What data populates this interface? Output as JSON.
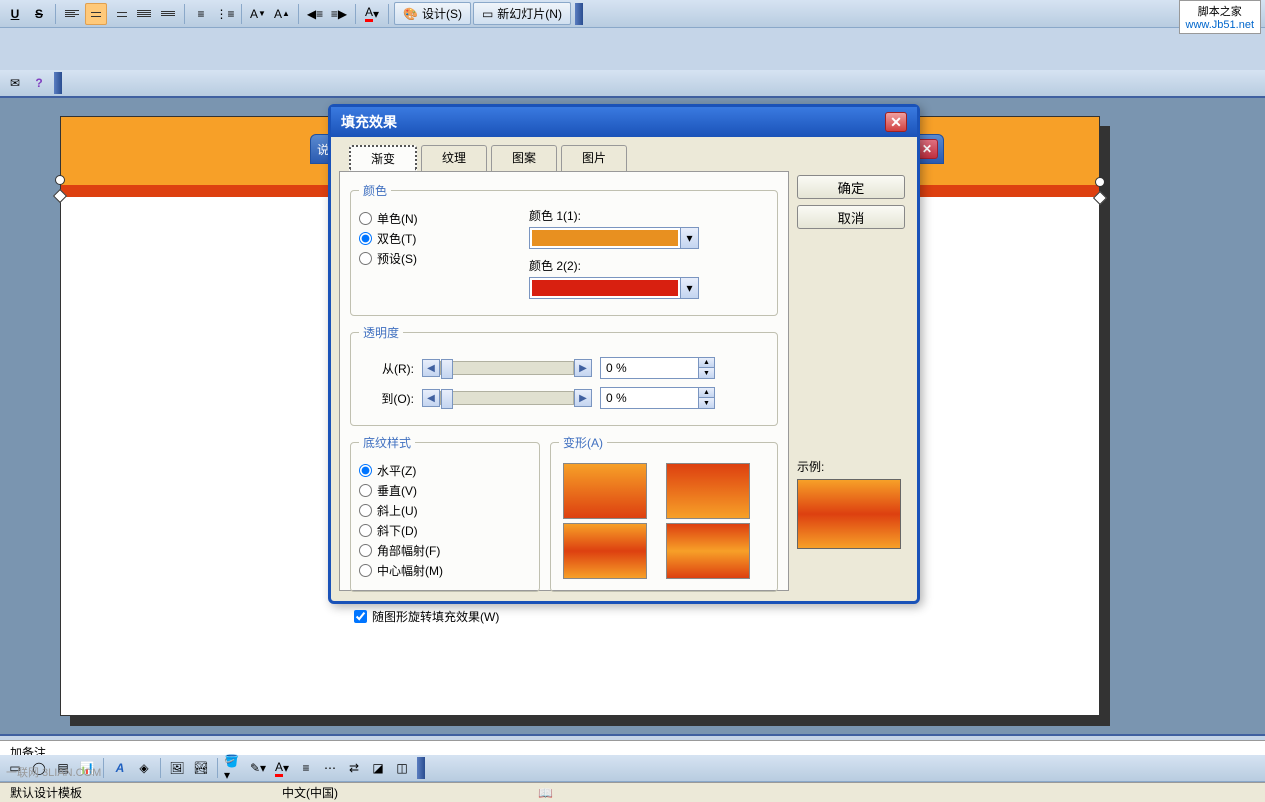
{
  "toolbar": {
    "underline": "U",
    "strike": "S",
    "design": "设计(S)",
    "new_slide": "新幻灯片(N)",
    "help": "?",
    "font_color": "A",
    "indent_dec": "A",
    "indent_inc": "A"
  },
  "watermark": {
    "name": "脚本之家",
    "url": "www.Jb51.net",
    "bottomleft": "一联网 3LIAN.COM"
  },
  "subdialog_title": "说",
  "dialog": {
    "title": "填充效果",
    "tabs": {
      "gradient": "渐变",
      "texture": "纹理",
      "pattern": "图案",
      "picture": "图片"
    },
    "color_group": "颜色",
    "single": "单色(N)",
    "double": "双色(T)",
    "preset": "预设(S)",
    "color1": "颜色 1(1):",
    "color2": "颜色 2(2):",
    "transparency_group": "透明度",
    "from": "从(R):",
    "to": "到(O):",
    "from_val": "0 %",
    "to_val": "0 %",
    "style_group": "底纹样式",
    "horizontal": "水平(Z)",
    "vertical": "垂直(V)",
    "diag_up": "斜上(U)",
    "diag_down": "斜下(D)",
    "corner": "角部幅射(F)",
    "center": "中心幅射(M)",
    "variant_group": "变形(A)",
    "sample": "示例:",
    "rotate": "随图形旋转填充效果(W)",
    "ok": "确定",
    "cancel": "取消"
  },
  "notes": "加备注",
  "status": {
    "template": "默认设计模板",
    "language": "中文(中国)"
  }
}
